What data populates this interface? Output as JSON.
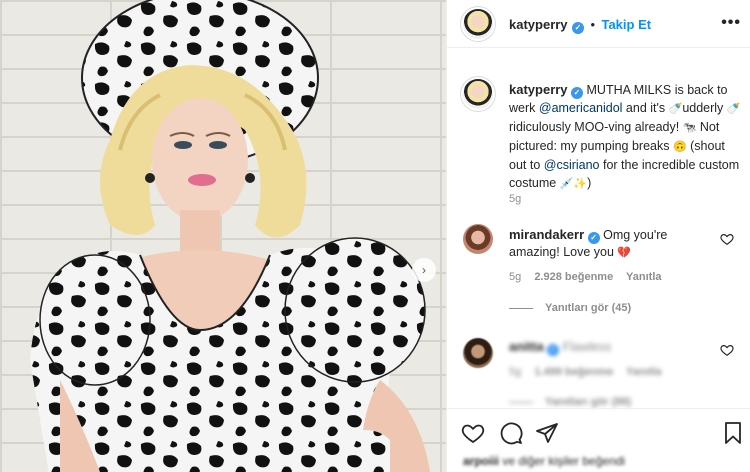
{
  "post": {
    "author": "katyperry",
    "follow_label": "Takip Et",
    "more_label": "•••",
    "caption": {
      "t1": " MUTHA MILKS is back to werk ",
      "mention1": "@americanidol",
      "t2": " and it's ",
      "emoji_bottle": "🍼",
      "t3": "udderly ",
      "t4": " ridiculously MOO-ving already! ",
      "emoji_cow": "🐄",
      "t5": " Not pictured: my pumping breaks ",
      "emoji_upside": "🙃",
      "t6": " (shout out to ",
      "mention2": "@csiriano",
      "t7": " for the incredible custom costume ",
      "emoji_needle": "💉",
      "emoji_sparkles": "✨",
      "t8": ")"
    },
    "time_ago": "5g"
  },
  "comments": [
    {
      "username": "mirandakerr",
      "text": "Omg you're amazing! Love you ",
      "emoji": "💔",
      "age": "5g",
      "likes": "2.928 beğenme",
      "reply_label": "Yanıtla",
      "view_replies": "Yanıtları gör (45)"
    },
    {
      "username": "anitta",
      "text": "Flawless",
      "age": "5g",
      "likes": "1.499 beğenme",
      "reply_label": "Yanıtla",
      "view_replies": "Yanıtları gör (88)"
    }
  ],
  "footer": {
    "liked_by_user": "arpoiii",
    "liked_by_rest": " ve diğer kişiler beğendi"
  },
  "icons": {
    "verified": "verified-badge-icon",
    "heart": "heart-icon",
    "comment": "comment-icon",
    "share": "share-icon",
    "save": "bookmark-icon",
    "next": "chevron-right-icon"
  },
  "colors": {
    "link": "#00376b",
    "follow": "#0095f6",
    "verified": "#3897f0",
    "secondary_text": "#8e8e8e"
  }
}
